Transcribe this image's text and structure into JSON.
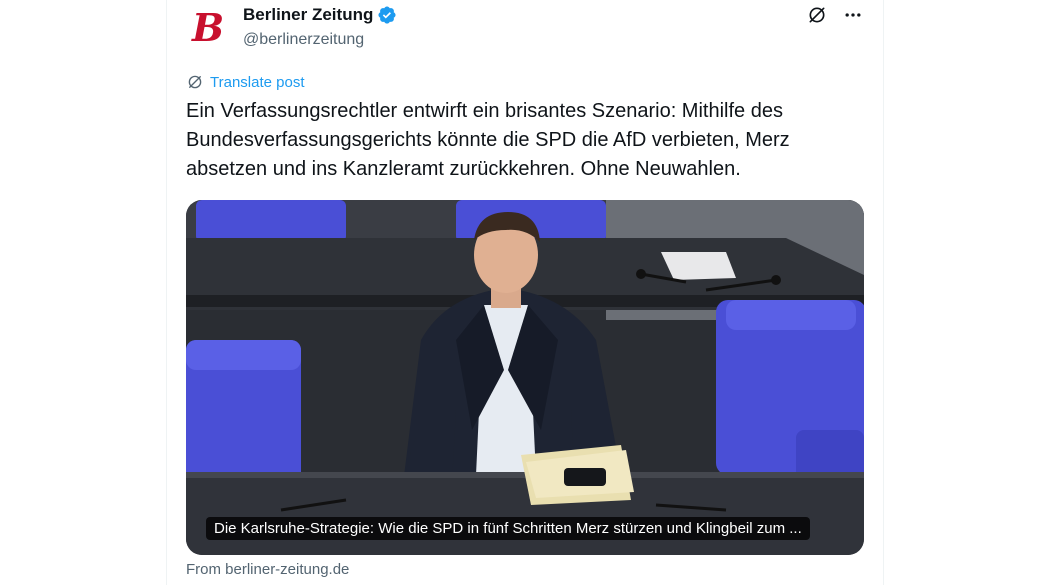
{
  "author": {
    "display_name": "Berliner Zeitung",
    "handle": "@berlinerzeitung",
    "avatar_letter": "B",
    "avatar_color": "#c8102e",
    "verified": true,
    "verified_color": "#1d9bf0"
  },
  "actions": {
    "grok_icon": "slash-circle-icon",
    "more_icon": "more-horizontal-icon"
  },
  "translate_label": "Translate post",
  "post_text": "Ein Verfassungsrechtler entwirft ein brisantes Szenario: Mithilfe des Bundesverfassungsgerichts könnte die SPD die AfD verbieten, Merz absetzen und ins Kanzleramt zurückkehren. Ohne Neuwahlen.",
  "card": {
    "caption": "Die Karlsruhe-Strategie: Wie die SPD in fünf Schritten Merz stürzen und Klingbeil zum ...",
    "source": "From berliner-zeitung.de"
  },
  "colors": {
    "text": "#0f1419",
    "secondary": "#536471",
    "link": "#1d9bf0",
    "seat_blue": "#4a4fd6"
  }
}
